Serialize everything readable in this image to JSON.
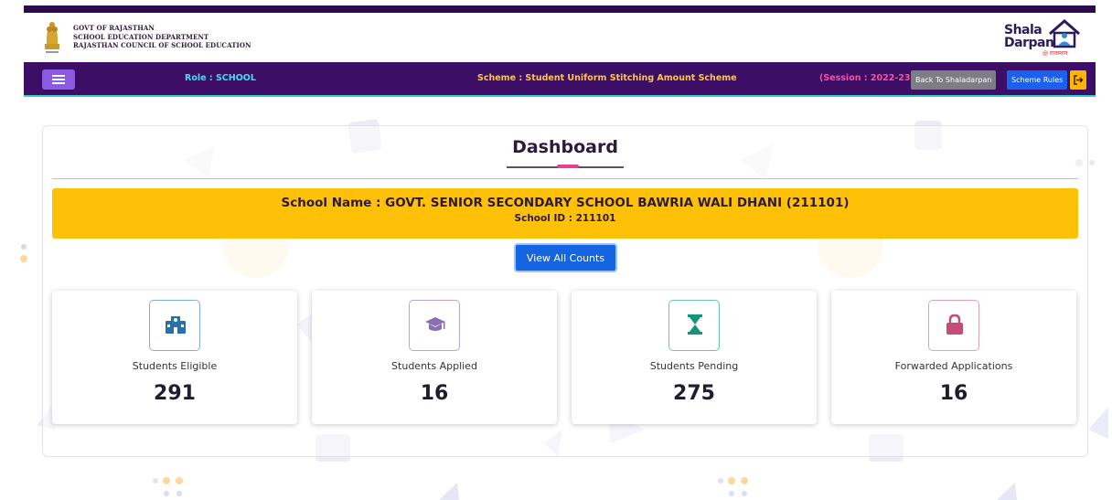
{
  "header": {
    "org_line1": "GOVT OF RAJASTHAN",
    "org_line2": "SCHOOL EDUCATION DEPARTMENT",
    "org_line3": "RAJASTHAN COUNCIL OF SCHOOL EDUCATION",
    "logo_line1": "Shala",
    "logo_line2": "Darpan",
    "logo_tag": "@ राजस्थान"
  },
  "navbar": {
    "role": "Role : SCHOOL",
    "scheme": "Scheme : Student Uniform Stitching Amount Scheme",
    "session": "(Session : 2022-23)",
    "back_label": "Back To Shaladarpan",
    "rules_label": "Scheme Rules"
  },
  "dashboard": {
    "title": "Dashboard",
    "school_name": "School Name : GOVT. SENIOR SECONDARY SCHOOL BAWRIA WALI DHANI (211101)",
    "school_id": "School ID : 211101",
    "view_all_label": "View All Counts"
  },
  "stats": [
    {
      "label": "Students Eligible",
      "value": "291",
      "icon": "school-building-icon",
      "color": "#2a6fa5"
    },
    {
      "label": "Students Applied",
      "value": "16",
      "icon": "graduation-cap-icon",
      "color": "#8a6fb5"
    },
    {
      "label": "Students Pending",
      "value": "275",
      "icon": "hourglass-icon",
      "color": "#13957a"
    },
    {
      "label": "Forwarded Applications",
      "value": "16",
      "icon": "lock-icon",
      "color": "#c44c77"
    }
  ],
  "colors": {
    "nav_bg": "#3d0e66",
    "role_text": "#3ee0f2",
    "scheme_text": "#ffca2c",
    "session_text": "#ff4fa3",
    "school_banner": "#ffc107",
    "primary_button": "#1565e0"
  }
}
